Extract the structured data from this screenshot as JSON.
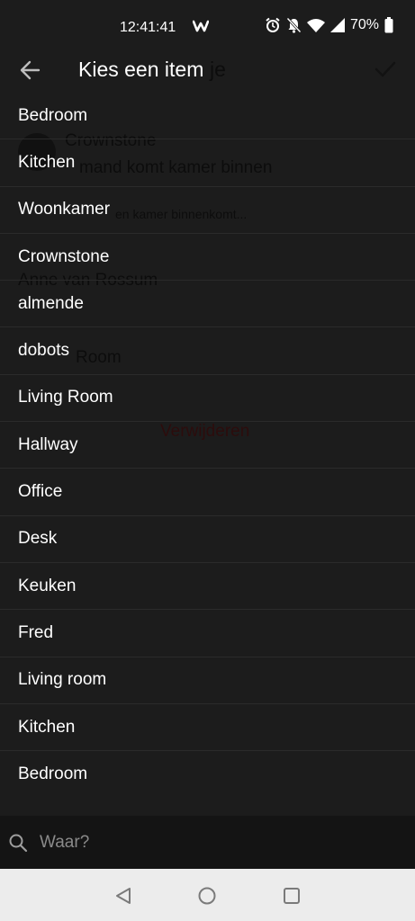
{
  "status": {
    "time": "12:41:41",
    "battery": "70%",
    "icons": [
      "app-w-icon",
      "alarm-icon",
      "notifications-off-icon",
      "wifi-icon",
      "signal-icon",
      "battery-icon"
    ]
  },
  "header": {
    "title": "Kies een item",
    "back_icon": "arrow-left-icon",
    "confirm_icon": "check-icon"
  },
  "background": {
    "title_fragment": "je",
    "card_title": "Crownstone",
    "card_subtitle": "mand komt kamer binnen",
    "card_hint": "en kamer binnenkomt...",
    "person": "Anne van Rossum",
    "room": "Room",
    "delete": "Verwijderen"
  },
  "items": [
    {
      "label": "Bedroom"
    },
    {
      "label": "Kitchen"
    },
    {
      "label": "Woonkamer"
    },
    {
      "label": "Crownstone"
    },
    {
      "label": "almende"
    },
    {
      "label": "dobots"
    },
    {
      "label": "Living Room"
    },
    {
      "label": "Hallway"
    },
    {
      "label": "Office"
    },
    {
      "label": "Desk"
    },
    {
      "label": "Keuken"
    },
    {
      "label": "Fred"
    },
    {
      "label": "Living room"
    },
    {
      "label": "Kitchen"
    },
    {
      "label": "Bedroom"
    }
  ],
  "search": {
    "placeholder": "Waar?",
    "icon": "search-icon"
  },
  "navbar": {
    "icons": [
      "back-triangle-icon",
      "home-circle-icon",
      "recents-square-icon"
    ]
  }
}
